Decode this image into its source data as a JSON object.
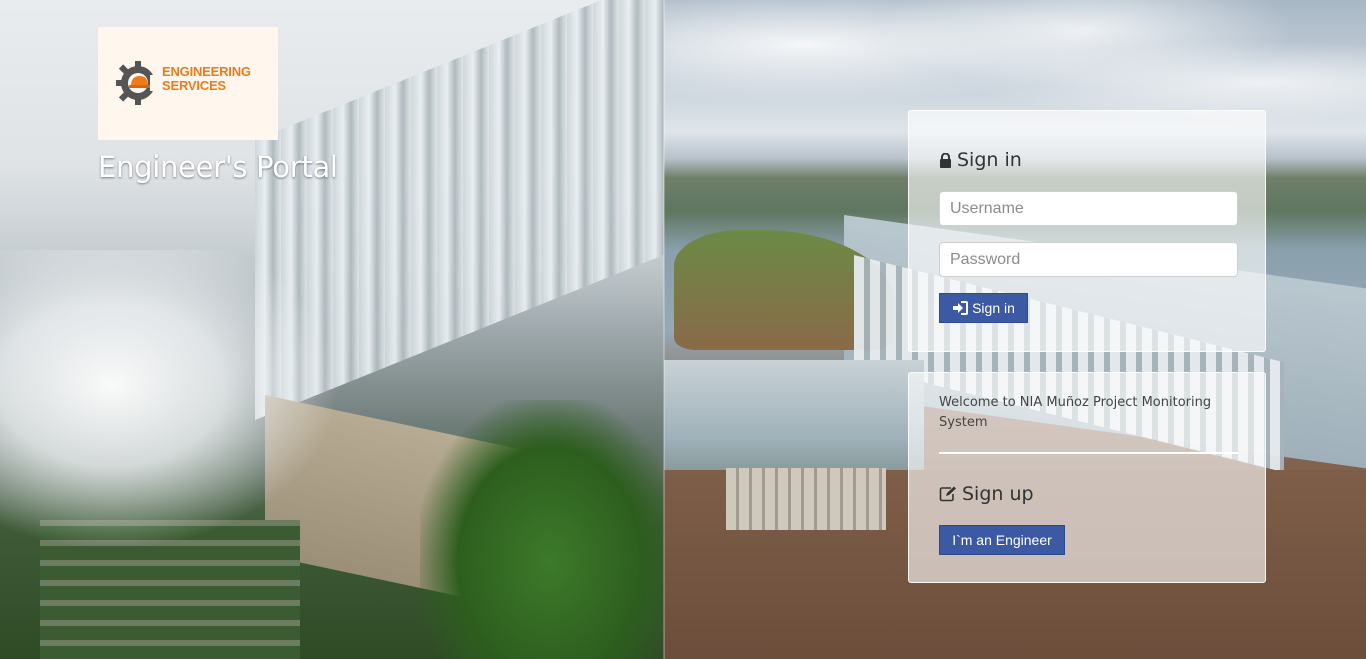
{
  "brand": {
    "logo_line1": "ENGINEERING",
    "logo_line2": "SERVICES",
    "portal_title": "Engineer's Portal"
  },
  "signin": {
    "title": "Sign in",
    "username_placeholder": "Username",
    "password_placeholder": "Password",
    "button_label": "Sign in"
  },
  "signup": {
    "welcome_text": "Welcome to NIA Muñoz Project Monitoring System",
    "title": "Sign up",
    "button_label": "I`m an Engineer"
  },
  "colors": {
    "button_bg": "#3b5aa3",
    "logo_orange": "#f07a1a",
    "panel_bg": "rgba(255,255,255,0.62)"
  },
  "icons": {
    "signin_title": "lock-icon",
    "signin_button": "sign-in-icon",
    "signup_title": "edit-icon",
    "logo": "gear-helmet-icon"
  }
}
